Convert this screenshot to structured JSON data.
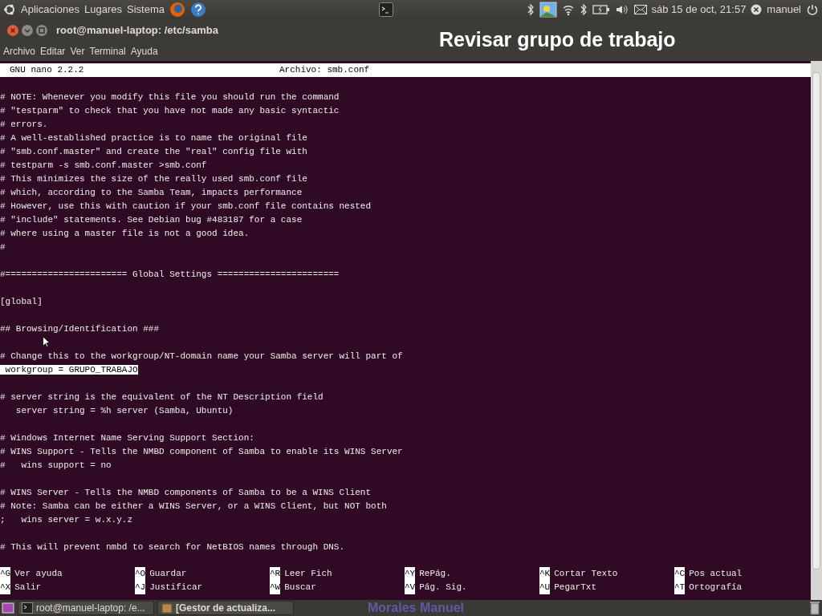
{
  "top_panel": {
    "menus": [
      "Aplicaciones",
      "Lugares",
      "Sistema"
    ],
    "clock": "sáb 15 de oct, 21:57",
    "user": "manuel"
  },
  "window": {
    "title": "root@manuel-laptop: /etc/samba",
    "menu": [
      "Archivo",
      "Editar",
      "Ver",
      "Terminal",
      "Ayuda"
    ]
  },
  "caption": "Revisar grupo de trabajo",
  "nano": {
    "version": "GNU nano 2.2.2",
    "file": "Archivo: smb.conf",
    "paragraphs": [
      [
        {
          "text": "# NOTE: Whenever you modify this file you should run the command",
          "selected": false
        },
        {
          "text": "# \"testparm\" to check that you have not made any basic syntactic",
          "selected": false
        },
        {
          "text": "# errors.",
          "selected": false
        },
        {
          "text": "# A well-established practice is to name the original file",
          "selected": false
        },
        {
          "text": "# \"smb.conf.master\" and create the \"real\" config file with",
          "selected": false
        },
        {
          "text": "# testparm -s smb.conf.master >smb.conf",
          "selected": false
        },
        {
          "text": "# This minimizes the size of the really used smb.conf file",
          "selected": false
        },
        {
          "text": "# which, according to the Samba Team, impacts performance",
          "selected": false
        },
        {
          "text": "# However, use this with caution if your smb.conf file contains nested",
          "selected": false
        },
        {
          "text": "# \"include\" statements. See Debian bug #483187 for a case",
          "selected": false
        },
        {
          "text": "# where using a master file is not a good idea.",
          "selected": false
        },
        {
          "text": "#",
          "selected": false
        }
      ],
      [
        {
          "text": "#======================= Global Settings =======================",
          "selected": false
        }
      ],
      [
        {
          "text": "[global]",
          "selected": false
        }
      ],
      [
        {
          "text": "## Browsing/Identification ###",
          "selected": false
        }
      ],
      [
        {
          "text": "# Change this to the workgroup/NT-domain name your Samba server will part of",
          "selected": false
        },
        {
          "text": " workgroup = GRUPO_TRABAJO",
          "selected": true
        }
      ],
      [
        {
          "text": "# server string is the equivalent of the NT Description field",
          "selected": false
        },
        {
          "text": "   server string = %h server (Samba, Ubuntu)",
          "selected": false
        }
      ],
      [
        {
          "text": "# Windows Internet Name Serving Support Section:",
          "selected": false
        },
        {
          "text": "# WINS Support - Tells the NMBD component of Samba to enable its WINS Server",
          "selected": false
        },
        {
          "text": "#   wins support = no",
          "selected": false
        }
      ],
      [
        {
          "text": "# WINS Server - Tells the NMBD components of Samba to be a WINS Client",
          "selected": false
        },
        {
          "text": "# Note: Samba can be either a WINS Server, or a WINS Client, but NOT both",
          "selected": false
        },
        {
          "text": ";   wins server = w.x.y.z",
          "selected": false
        }
      ],
      [
        {
          "text": "# This will prevent nmbd to search for NetBIOS names through DNS.",
          "selected": false
        }
      ]
    ],
    "shortcuts": [
      {
        "key": "^G",
        "label": "Ver ayuda"
      },
      {
        "key": "^O",
        "label": "Guardar"
      },
      {
        "key": "^R",
        "label": "Leer Fich"
      },
      {
        "key": "^Y",
        "label": "RePág."
      },
      {
        "key": "^K",
        "label": "Cortar Texto"
      },
      {
        "key": "^C",
        "label": "Pos actual"
      },
      {
        "key": "^X",
        "label": "Salir"
      },
      {
        "key": "^J",
        "label": "Justificar"
      },
      {
        "key": "^W",
        "label": "Buscar"
      },
      {
        "key": "^V",
        "label": "Pág. Sig."
      },
      {
        "key": "^U",
        "label": "PegarTxt"
      },
      {
        "key": "^T",
        "label": "Ortografía"
      }
    ]
  },
  "taskbar": {
    "tasks": [
      {
        "kind": "terminal",
        "label": "root@manuel-laptop: /e..."
      },
      {
        "kind": "updater",
        "label": "[Gestor de actualiza..."
      }
    ],
    "credit": "Morales Manuel"
  }
}
